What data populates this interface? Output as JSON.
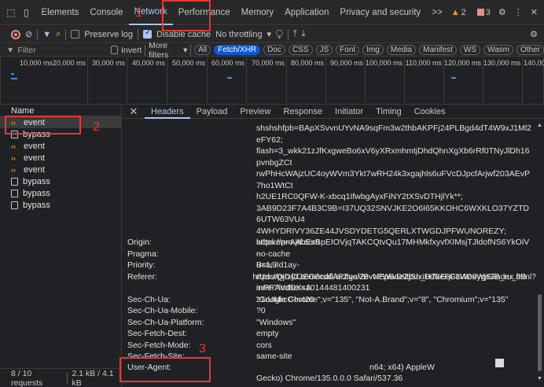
{
  "top_tabs": [
    "Elements",
    "Console",
    "Network",
    "Performance",
    "Memory",
    "Application",
    "Privacy and security",
    ">>"
  ],
  "top_right": {
    "warnings": "2",
    "errors": "3"
  },
  "toolbar": {
    "preserve_log": "Preserve log",
    "disable_cache": "Disable cache",
    "throttling": "No throttling"
  },
  "filter_bar": {
    "placeholder": "Filter",
    "invert": "Invert",
    "more_filters": "More filters",
    "chips": [
      "All",
      "Fetch/XHR",
      "Doc",
      "CSS",
      "JS",
      "Font",
      "Img",
      "Media",
      "Manifest",
      "WS",
      "Wasm",
      "Other"
    ]
  },
  "timeline_ticks": [
    "10,000 ms",
    "20,000 ms",
    "30,000 ms",
    "40,000 ms",
    "50,000 ms",
    "60,000 ms",
    "70,000 ms",
    "80,000 ms",
    "90,000 ms",
    "100,000 ms",
    "110,000 ms",
    "120,000 ms",
    "130,000 ms",
    "140,00"
  ],
  "requests": {
    "header": "Name",
    "items": [
      {
        "name": "event",
        "type": "fetch"
      },
      {
        "name": "bypass",
        "type": "doc"
      },
      {
        "name": "event",
        "type": "fetch"
      },
      {
        "name": "event",
        "type": "fetch"
      },
      {
        "name": "event",
        "type": "fetch"
      },
      {
        "name": "bypass",
        "type": "doc"
      },
      {
        "name": "bypass",
        "type": "doc"
      },
      {
        "name": "bypass",
        "type": "doc"
      }
    ]
  },
  "status": {
    "requests": "8 / 10 requests",
    "transferred": "2.1 kB / 4.1 kB"
  },
  "detail_tabs": [
    "Headers",
    "Payload",
    "Preview",
    "Response",
    "Initiator",
    "Timing",
    "Cookies"
  ],
  "cookie_lines": [
    "shshshfpb=BApXSvvnUYvNA9sqFm3w2thbAKPFj24PLBgd4dT4W9xJ1Ml2eFY62;",
    "flash=3_wkk21zJfKxgweBo6xV6yXRxmhmtjDhdQhnXgXb6rRf0TNyJlDh16pvnbgZCt",
    "rwPhHcWAjzUC4oyWVm3Ykt7wRH24k3xgajhls6uFVcDJpcfArjwf203AEvP7ho1WtCt",
    "h2UE1RC0QFW-K-xbcq1IfwbgAyxFiNY2tXSvDTHjlYk**;",
    "3AB9D23F7A4B3C9B=I37UQ32SNVJKE2O6I65KKOHC6WXKLO37YZTD6UTW63VU4",
    "4WHYDRIVY36ZE44JVSDYDETG5QERLXTWGDJPFWUNOREZY;",
    "sdtoken=AAbEsBpEIOVjqTAKCQtvQu17MHMkfxyvfXIMsjTJldofNS6YkOiV-",
    "Bsw9Id1ay-",
    "rUdsrQjDCOEG6cd6AFZgaVBvNEpBoeZjSh_H7xeFGzWe0ygs3B_ru_9BmPF7lV4DKsA",
    "z1rUMrcGevI20"
  ],
  "headers": [
    {
      "k": "Origin:",
      "v": "https://pro.jd.com"
    },
    {
      "k": "Pragma:",
      "v": "no-cache"
    },
    {
      "k": "Priority:",
      "v": "u=1, i"
    },
    {
      "k": "Referer:",
      "v": "https://pro.jd.com/mall/active/2evvPWwD9tbuxiDdBEqF8i4DxWjS/index.html?"
    },
    {
      "k": "",
      "v": "innerAnchor=10144481400231"
    },
    {
      "k": "Sec-Ch-Ua:",
      "v": "\"Google Chrome\";v=\"135\", \"Not-A.Brand\";v=\"8\", \"Chromium\";v=\"135\""
    },
    {
      "k": "Sec-Ch-Ua-Mobile:",
      "v": "?0"
    },
    {
      "k": "Sec-Ch-Ua-Platform:",
      "v": "\"Windows\""
    },
    {
      "k": "Sec-Fetch-Dest:",
      "v": "empty"
    },
    {
      "k": "Sec-Fetch-Mode:",
      "v": "cors"
    },
    {
      "k": "Sec-Fetch-Site:",
      "v": "same-site"
    },
    {
      "k": "User-Agent:",
      "v": "n64; x64) AppleW"
    },
    {
      "k": "",
      "v": "Gecko) Chrome/135.0.0.0 Safari/537.36"
    }
  ],
  "annotations": [
    "1",
    "2",
    "3"
  ]
}
